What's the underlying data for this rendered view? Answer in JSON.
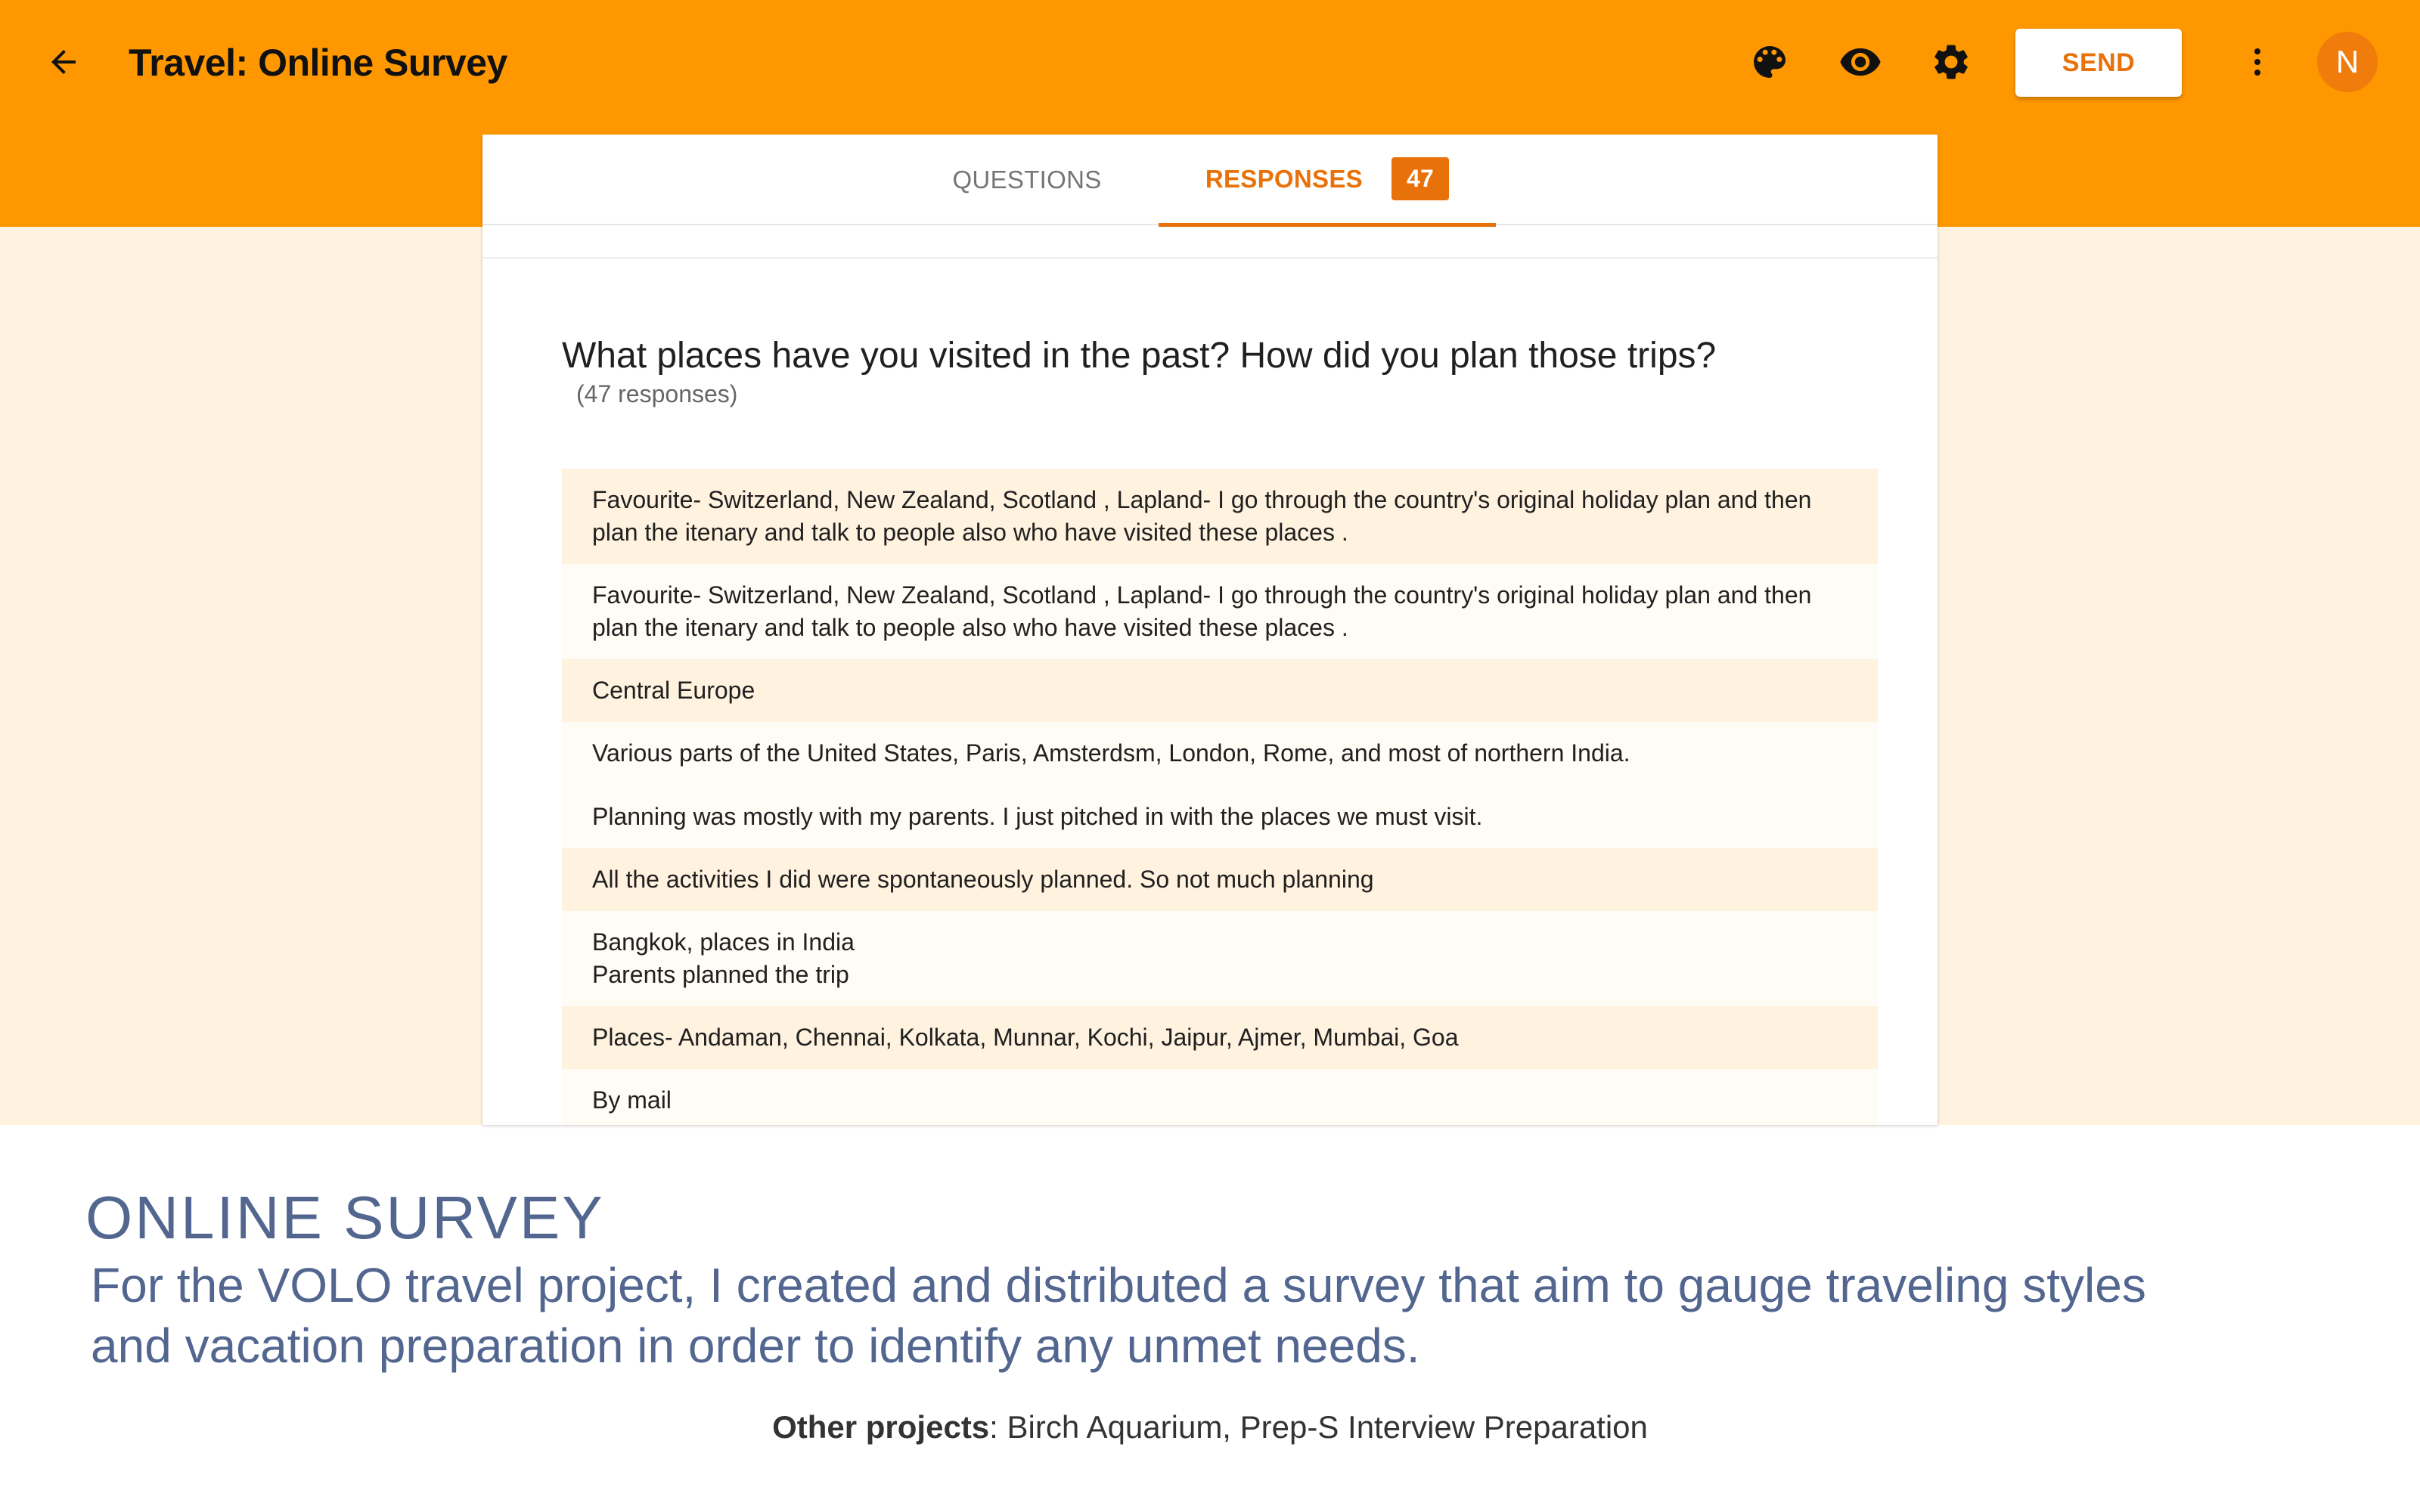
{
  "app_bar": {
    "title": "Travel: Online Survey",
    "send_label": "SEND",
    "avatar_initial": "N",
    "icons": [
      "arrow-back-icon",
      "palette-icon",
      "eye-icon",
      "gear-icon",
      "more-vert-icon"
    ],
    "color": "#ff9800"
  },
  "tabs": {
    "questions_label": "QUESTIONS",
    "responses_label": "RESPONSES",
    "responses_count": "47",
    "active": "responses",
    "accent_color": "#e8710a"
  },
  "question": {
    "text": "What places have you visited in the past? How did you plan those trips?",
    "count_text": "(47 responses)"
  },
  "responses": [
    {
      "lines": [
        "Favourite- Switzerland, New Zealand, Scotland , Lapland- I go through the country's original holiday plan and then",
        "plan the itenary and talk to people also who have visited these places ."
      ]
    },
    {
      "lines": [
        "Favourite- Switzerland, New Zealand, Scotland , Lapland- I go through the country's original holiday plan and then",
        "plan the itenary and talk to people also who have visited these places ."
      ]
    },
    {
      "lines": [
        "Central Europe"
      ]
    },
    {
      "lines": [
        "Various parts of the United States, Paris, Amsterdsm, London, Rome, and most of northern India.",
        "Planning was mostly with my parents. I just pitched in with the places we must visit."
      ]
    },
    {
      "lines": [
        "All the activities I did were spontaneously planned. So not much planning"
      ]
    },
    {
      "lines": [
        "Bangkok, places in India",
        "Parents planned the trip"
      ]
    },
    {
      "lines": [
        "Places- Andaman, Chennai, Kolkata, Munnar, Kochi, Jaipur, Ajmer, Mumbai, Goa"
      ]
    },
    {
      "lines": [
        "By mail"
      ]
    }
  ],
  "caption": {
    "title": "ONLINE SURVEY",
    "body_line1": "For the VOLO travel project, I created and distributed a survey that aim to gauge traveling styles",
    "body_line2": "and vacation preparation in order to identify any unmet needs.",
    "other_label": "Other projects",
    "other_value": ": Birch Aquarium, Prep-S Interview Preparation"
  }
}
